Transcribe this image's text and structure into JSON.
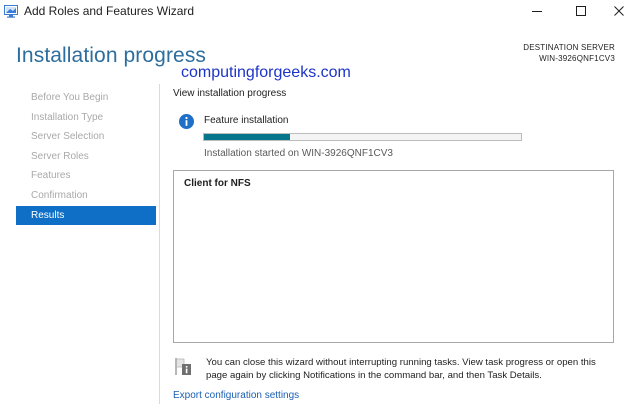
{
  "window": {
    "title": "Add Roles and Features Wizard",
    "icon": "server-manager-icon",
    "controls": [
      "minimize-icon",
      "maximize-icon",
      "close-icon"
    ]
  },
  "header": {
    "page_title": "Installation progress",
    "watermark": "computingforgeeks.com",
    "destination_label": "DESTINATION SERVER",
    "destination_server": "WIN-3926QNF1CV3"
  },
  "nav": {
    "items": [
      {
        "label": "Before You Begin",
        "active": false
      },
      {
        "label": "Installation Type",
        "active": false
      },
      {
        "label": "Server Selection",
        "active": false
      },
      {
        "label": "Server Roles",
        "active": false
      },
      {
        "label": "Features",
        "active": false
      },
      {
        "label": "Confirmation",
        "active": false
      },
      {
        "label": "Results",
        "active": true
      }
    ]
  },
  "main": {
    "heading": "View installation progress",
    "status_icon": "info-icon",
    "feature_label": "Feature installation",
    "progress_percent": 27,
    "started_text": "Installation started on WIN-3926QNF1CV3",
    "results": [
      "Client for NFS"
    ],
    "note_icon": "notification-flag-icon",
    "note_text": "You can close this wizard without interrupting running tasks. View task progress or open this page again by clicking Notifications in the command bar, and then Task Details.",
    "export_link": "Export configuration settings"
  },
  "colors": {
    "title_blue": "#2d6e9e",
    "active_nav": "#0f6fc6",
    "progress": "#06768d",
    "link": "#1a5fb4",
    "watermark": "#1c34c8"
  }
}
